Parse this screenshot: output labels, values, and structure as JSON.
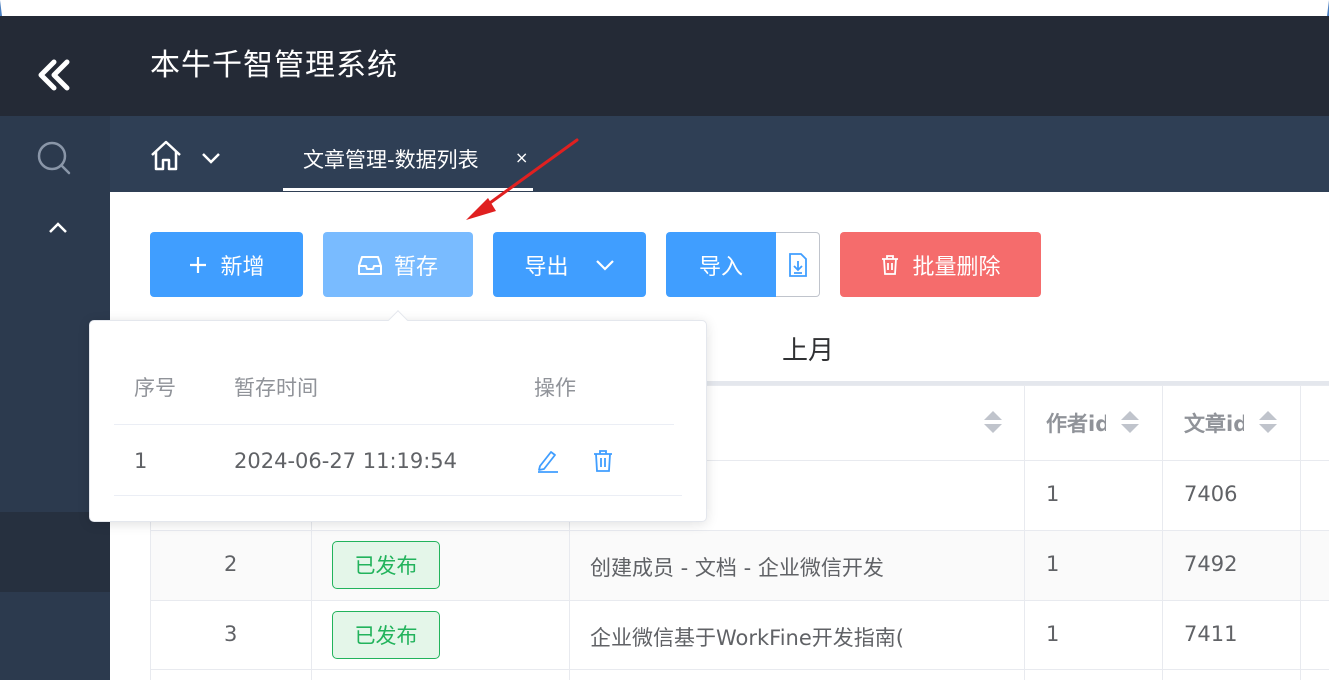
{
  "app": {
    "title": "本牛千智管理系统"
  },
  "tabs": [
    {
      "label": "文章管理-数据列表",
      "close": "×"
    }
  ],
  "toolbar": {
    "add_label": "新增",
    "save_label": "暂存",
    "export_label": "导出",
    "import_label": "导入",
    "batch_delete_label": "批量删除"
  },
  "period_tab": "上月",
  "table": {
    "columns": [
      "作者id",
      "文章id"
    ],
    "rows": [
      {
        "seq": "",
        "status": "",
        "title": "",
        "author_id": "1",
        "article_id": "7406"
      },
      {
        "seq": "2",
        "status": "已发布",
        "title": "创建成员 - 文档 - 企业微信开发",
        "author_id": "1",
        "article_id": "7492"
      },
      {
        "seq": "3",
        "status": "已发布",
        "title": "企业微信基于WorkFine开发指南(",
        "author_id": "1",
        "article_id": "7411"
      }
    ]
  },
  "draft_popover": {
    "headers": {
      "seq": "序号",
      "time": "暂存时间",
      "action": "操作"
    },
    "rows": [
      {
        "seq": "1",
        "time": "2024-06-27 11:19:54"
      }
    ]
  },
  "colors": {
    "topbar": "#242a36",
    "sidebar": "#2c3a4e",
    "primary": "#409eff",
    "danger": "#f56c6c",
    "success": "#22b35c",
    "annotation_arrow": "#e02020"
  },
  "icons": [
    "double-chevron-left-icon",
    "search-icon",
    "chevron-up-icon",
    "home-icon",
    "chevron-down-icon",
    "plus-icon",
    "inbox-icon",
    "download-icon",
    "trash-icon",
    "edit-icon",
    "sort-icon"
  ]
}
